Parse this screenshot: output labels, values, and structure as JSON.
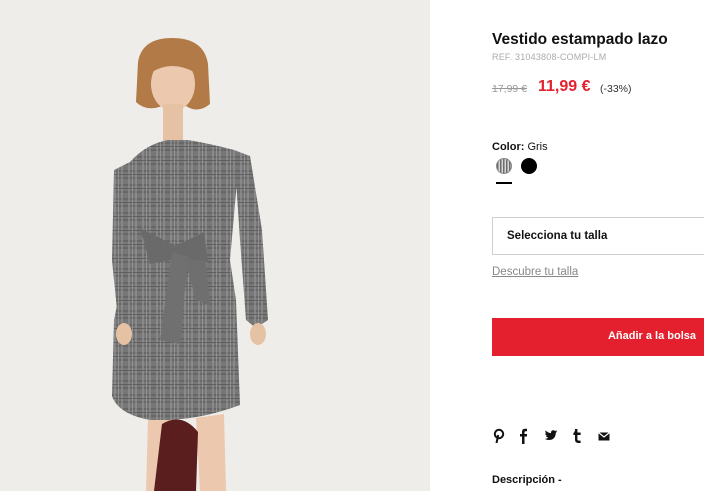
{
  "product": {
    "title": "Vestido estampado lazo",
    "ref": "REF. 31043808-COMPI-LM",
    "old_price": "17,99 €",
    "new_price": "11,99 €",
    "discount": "(-33%)"
  },
  "color": {
    "label": "Color:",
    "selected": "Gris",
    "swatches": [
      {
        "name": "Gris",
        "color": "#8a8a8a"
      },
      {
        "name": "Negro",
        "color": "#000000"
      }
    ]
  },
  "size": {
    "select_label": "Selecciona tu talla",
    "guide_link": "Descubre tu talla"
  },
  "actions": {
    "add_to_bag": "Añadir a la bolsa"
  },
  "share": {
    "icons": [
      "pinterest-icon",
      "facebook-icon",
      "twitter-icon",
      "tumblr-icon",
      "email-icon"
    ]
  },
  "description": {
    "label": "Descripción  -"
  },
  "colors": {
    "accent": "#e5202e",
    "background": "#ffffff",
    "photo_background": "#efede9"
  }
}
